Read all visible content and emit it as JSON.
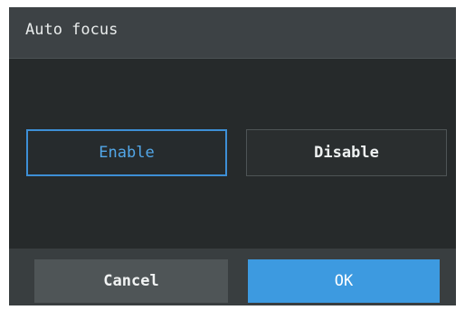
{
  "dialog": {
    "title": "Auto focus"
  },
  "options": {
    "enable_label": "Enable",
    "disable_label": "Disable",
    "selected": "Enable"
  },
  "footer": {
    "cancel_label": "Cancel",
    "ok_label": "OK"
  },
  "colors": {
    "accent": "#3d9ae0",
    "selected_border": "#3d8fd6",
    "background": "#262a2b",
    "title_bar": "#3d4245",
    "footer": "#393e40"
  }
}
